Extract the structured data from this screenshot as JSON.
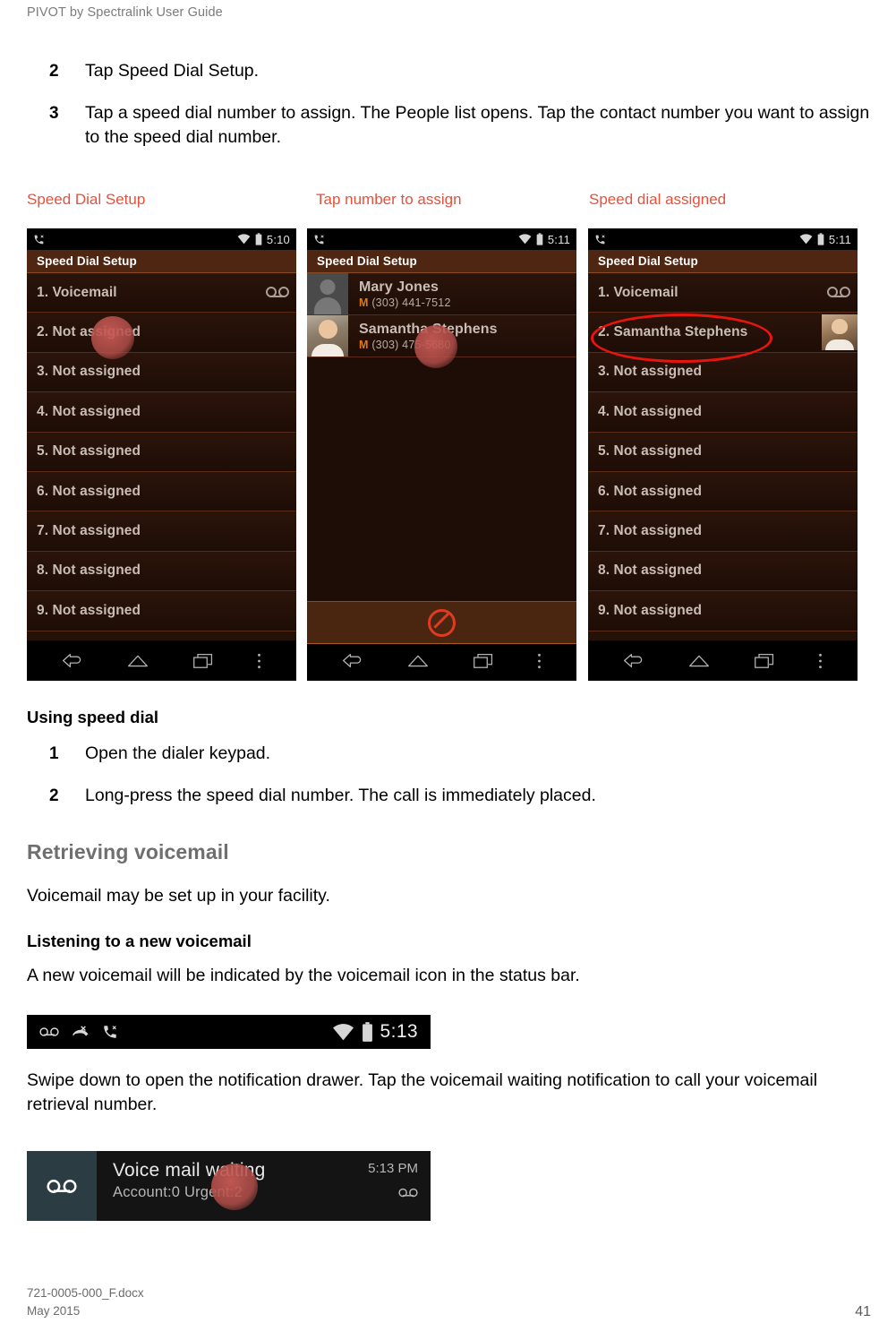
{
  "document": {
    "running_header": "PIVOT by Spectralink User Guide",
    "footer_file": "721-0005-000_F.docx",
    "footer_date": "May 2015",
    "page_number": "41",
    "caption_color": "#e8503a",
    "heading_color": "#6f6f6f"
  },
  "steps_top": [
    {
      "number": "2",
      "text": "Tap Speed Dial Setup."
    },
    {
      "number": "3",
      "text": "Tap a speed dial number to assign. The People list opens. Tap the contact number you want to assign to the speed dial number."
    }
  ],
  "figure_captions": [
    {
      "label": "Speed Dial Setup"
    },
    {
      "label": "Tap number to assign"
    },
    {
      "label": "Speed dial assigned"
    }
  ],
  "phone1": {
    "status": {
      "time": "5:10",
      "left_icons": [
        "call-icon"
      ],
      "right_icons": [
        "wifi-icon",
        "battery-icon"
      ]
    },
    "action_bar_title": "Speed Dial Setup",
    "rows": [
      {
        "label": "1. Voicemail",
        "accessory": "voicemail-icon"
      },
      {
        "label": "2. Not assigned",
        "accessory": "none"
      },
      {
        "label": "3. Not assigned",
        "accessory": "none"
      },
      {
        "label": "4. Not assigned",
        "accessory": "none"
      },
      {
        "label": "5. Not assigned",
        "accessory": "none"
      },
      {
        "label": "6. Not assigned",
        "accessory": "none"
      },
      {
        "label": "7. Not assigned",
        "accessory": "none"
      },
      {
        "label": "8. Not assigned",
        "accessory": "none"
      },
      {
        "label": "9. Not assigned",
        "accessory": "none"
      }
    ],
    "nav": [
      "back-icon",
      "home-icon",
      "recents-icon",
      "overflow-menu-icon"
    ]
  },
  "phone2": {
    "status": {
      "time": "5:11",
      "left_icons": [
        "call-icon"
      ],
      "right_icons": [
        "wifi-icon",
        "battery-icon"
      ]
    },
    "action_bar_title": "Speed Dial Setup",
    "contacts": [
      {
        "name": "Mary Jones",
        "type": "M",
        "number": "(303) 441-7512",
        "avatar": "generic"
      },
      {
        "name": "Samantha Stephens",
        "type": "M",
        "number": "(303) 475-5680",
        "avatar": "photo"
      }
    ],
    "footer_icon": "no-entry-icon",
    "nav": [
      "back-icon",
      "home-icon",
      "recents-icon",
      "overflow-menu-icon"
    ]
  },
  "phone3": {
    "status": {
      "time": "5:11",
      "left_icons": [
        "call-icon"
      ],
      "right_icons": [
        "wifi-icon",
        "battery-icon"
      ]
    },
    "action_bar_title": "Speed Dial Setup",
    "rows": [
      {
        "label": "1. Voicemail",
        "accessory": "voicemail-icon"
      },
      {
        "label": "2. Samantha Stephens",
        "accessory": "contact-thumbnail"
      },
      {
        "label": "3. Not assigned",
        "accessory": "none"
      },
      {
        "label": "4. Not assigned",
        "accessory": "none"
      },
      {
        "label": "5. Not assigned",
        "accessory": "none"
      },
      {
        "label": "6. Not assigned",
        "accessory": "none"
      },
      {
        "label": "7. Not assigned",
        "accessory": "none"
      },
      {
        "label": "8. Not assigned",
        "accessory": "none"
      },
      {
        "label": "9. Not assigned",
        "accessory": "none"
      }
    ],
    "annotation_color": "#e8150f",
    "nav": [
      "back-icon",
      "home-icon",
      "recents-icon",
      "overflow-menu-icon"
    ]
  },
  "section_using_speed_dial": {
    "heading": "Using speed dial",
    "steps": [
      {
        "number": "1",
        "text": "Open the dialer keypad."
      },
      {
        "number": "2",
        "text": "Long-press the speed dial number. The call is immediately placed."
      }
    ]
  },
  "section_retrieving_voicemail": {
    "heading": "Retrieving voicemail",
    "paragraph": "Voicemail may be set up in your facility.",
    "subheading": "Listening to a new voicemail",
    "subparagraph": "A new voicemail will be indicated by the voicemail icon in the status bar.",
    "paragraph2": "Swipe down to open the notification drawer. Tap the voicemail waiting notification to call your voicemail retrieval number."
  },
  "figure_statusbar": {
    "left_icons": [
      "voicemail-icon",
      "missed-call-icon",
      "call-icon"
    ],
    "right_icons": [
      "wifi-icon",
      "battery-icon"
    ],
    "time": "5:13"
  },
  "figure_notification": {
    "icon": "voicemail-icon",
    "title": "Voice mail waiting",
    "subtitle": "Account:0 Urgent:2",
    "time": "5:13 PM",
    "trailing_icon": "voicemail-icon"
  }
}
